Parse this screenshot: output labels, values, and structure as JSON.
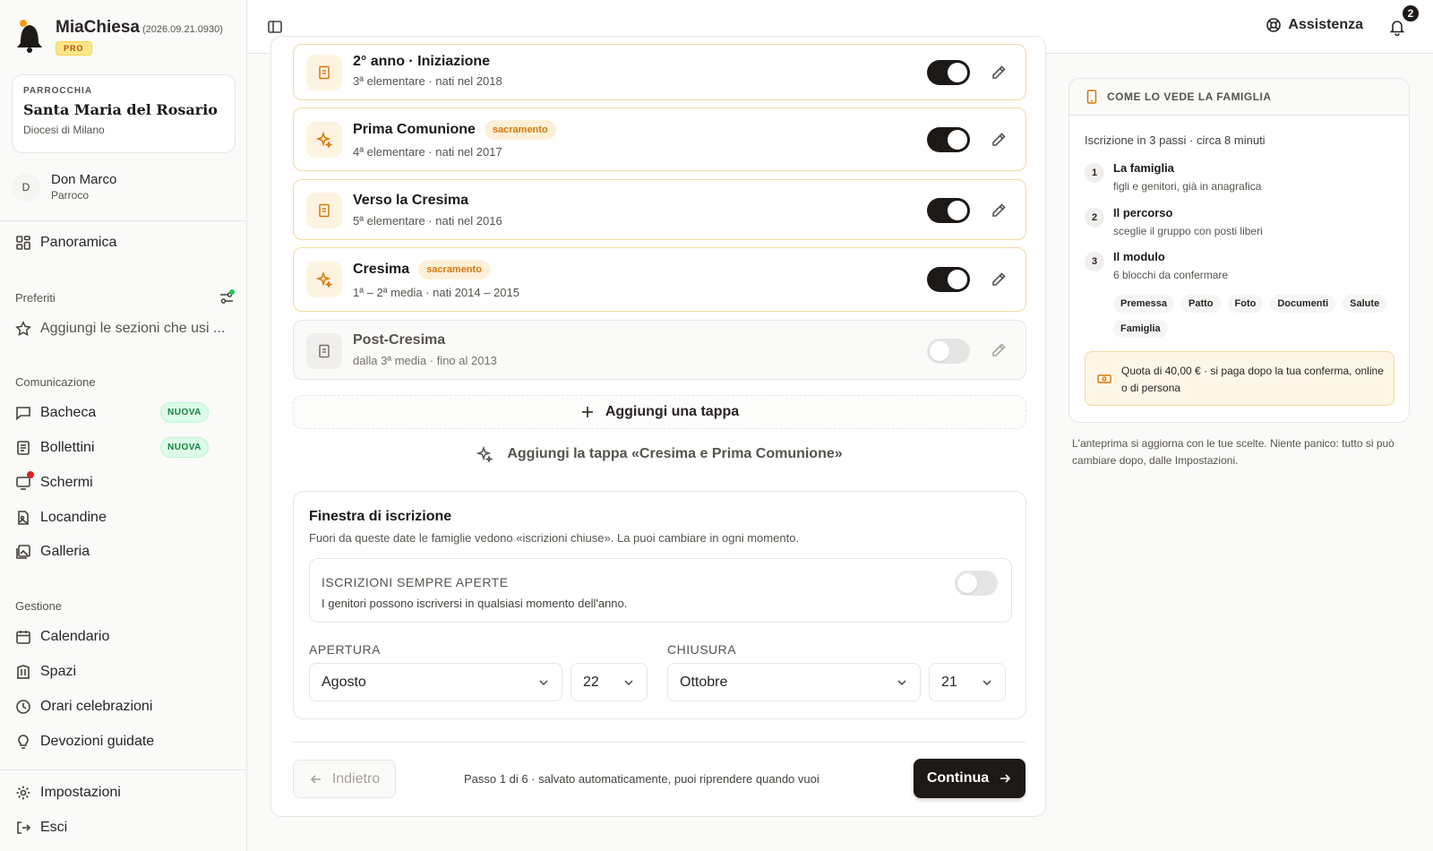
{
  "app": {
    "name": "MiaChiesa",
    "version": "(2026.09.21.0930)",
    "plan": "PRO"
  },
  "parish": {
    "kicker": "PARROCCHIA",
    "name": "Santa Maria del Rosario",
    "diocese": "Diocesi di Milano"
  },
  "user": {
    "initial": "D",
    "name": "Don Marco",
    "role": "Parroco"
  },
  "nav": {
    "overview": "Panoramica",
    "favorites_label": "Preferiti",
    "favorites_hint": "Aggiungi le sezioni che usi ...",
    "communication_label": "Comunicazione",
    "communication": [
      {
        "label": "Bacheca",
        "badge": "NUOVA"
      },
      {
        "label": "Bollettini",
        "badge": "NUOVA"
      },
      {
        "label": "Schermi"
      },
      {
        "label": "Locandine"
      },
      {
        "label": "Galleria"
      }
    ],
    "management_label": "Gestione",
    "management": [
      {
        "label": "Calendario"
      },
      {
        "label": "Spazi"
      },
      {
        "label": "Orari celebrazioni"
      },
      {
        "label": "Devozioni guidate"
      }
    ],
    "settings": "Impostazioni",
    "logout": "Esci"
  },
  "topbar": {
    "help": "Assistenza",
    "notifications": "2"
  },
  "stages": [
    {
      "title": "2° anno · Iniziazione",
      "sub": "3ª elementare · nati nel 2018",
      "badge": "",
      "enabled": true,
      "icon": "book-icon"
    },
    {
      "title": "Prima Comunione",
      "sub": "4ª elementare · nati nel 2017",
      "badge": "sacramento",
      "enabled": true,
      "icon": "sparkles-icon"
    },
    {
      "title": "Verso la Cresima",
      "sub": "5ª elementare · nati nel 2016",
      "badge": "",
      "enabled": true,
      "icon": "book-icon"
    },
    {
      "title": "Cresima",
      "sub": "1ª – 2ª media · nati 2014 – 2015",
      "badge": "sacramento",
      "enabled": true,
      "icon": "sparkles-icon"
    },
    {
      "title": "Post-Cresima",
      "sub": "dalla 3ª media · fino al 2013",
      "badge": "",
      "enabled": false,
      "icon": "book-icon"
    }
  ],
  "add_stage": "Aggiungi una tappa",
  "add_combo": "Aggiungi la tappa «Cresima e Prima Comunione»",
  "window": {
    "title": "Finestra di iscrizione",
    "sub": "Fuori da queste date le famiglie vedono «iscrizioni chiuse». La puoi cambiare in ogni momento.",
    "always_title": "ISCRIZIONI SEMPRE APERTE",
    "always_sub": "I genitori possono iscriversi in qualsiasi momento dell'anno.",
    "always_enabled": false,
    "open_label": "APERTURA",
    "open_month": "Agosto",
    "open_day": "22",
    "close_label": "CHIUSURA",
    "close_month": "Ottobre",
    "close_day": "21"
  },
  "footer": {
    "back": "Indietro",
    "note": "Passo 1 di 6 · salvato automaticamente, puoi riprendere quando vuoi",
    "next": "Continua"
  },
  "preview": {
    "header": "COME LO VEDE LA FAMIGLIA",
    "intro": "Iscrizione in 3 passi · circa 8 minuti",
    "steps": [
      {
        "num": "1",
        "title": "La famiglia",
        "sub": "figli e genitori, già in anagrafica"
      },
      {
        "num": "2",
        "title": "Il percorso",
        "sub": "sceglie il gruppo con posti liberi"
      },
      {
        "num": "3",
        "title": "Il modulo",
        "sub": "6 blocchi da confermare"
      }
    ],
    "chips": [
      "Premessa",
      "Patto",
      "Foto",
      "Documenti",
      "Salute",
      "Famiglia"
    ],
    "fee": "Quota di 40,00 € · si paga dopo la tua conferma, online o di persona",
    "note": "L'anteprima si aggiorna con le tue scelte. Niente panico: tutto si può cambiare dopo, dalle Impostazioni."
  },
  "colors": {
    "accent": "#d97706",
    "dark": "#1c1917",
    "success": "#15803d",
    "alert": "#dc2626"
  }
}
